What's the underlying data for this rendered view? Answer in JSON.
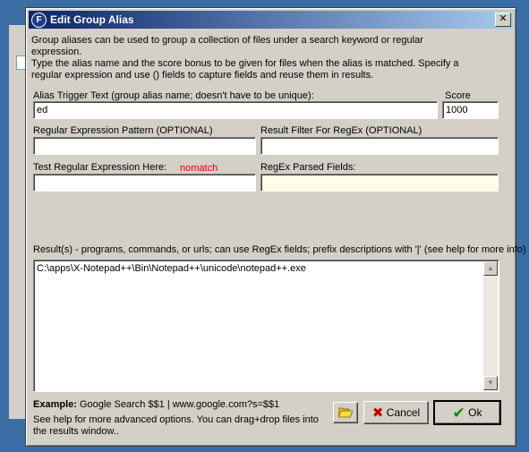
{
  "dialog": {
    "title": "Edit Group Alias",
    "app_icon_letter": "F",
    "close_glyph": "✕",
    "description": "Group aliases can be used to group a collection of files under a search keyword or regular expression.\nType the alias name and the score bonus to be given for files when the alias is matched.  Specify a regular expression and use () fields to capture fields and reuse them in results."
  },
  "fields": {
    "alias_label": "Alias Trigger Text (group alias name; doesn't have to be unique):",
    "alias_value": "ed",
    "score_label": "Score",
    "score_value": "1000",
    "regex_label": "Regular Expression Pattern (OPTIONAL)",
    "regex_value": "",
    "filter_label": "Result Filter For RegEx (OPTIONAL)",
    "filter_value": "",
    "test_label": "Test Regular Expression Here:",
    "test_value": "",
    "test_status": "nomatch",
    "parsed_label": "RegEx Parsed Fields:",
    "parsed_value": ""
  },
  "results": {
    "label": "Result(s) - programs, commands, or urls; can use RegEx fields; prefix descriptions with '|' (see help for more info)",
    "lines": [
      "C:\\apps\\X-Notepad++\\Bin\\Notepad++\\unicode\\notepad++.exe"
    ]
  },
  "footer": {
    "example_bold": "Example:",
    "example_text": " Google Search $$1 | www.google.com?s=$$1",
    "help_text": "See help for more advanced options.  You can drag+drop files into the results window.."
  },
  "buttons": {
    "cancel_label": "Cancel",
    "ok_label": "Ok"
  },
  "colors": {
    "title_start": "#0a246a",
    "title_end": "#a6caf0",
    "nomatch": "#e00000",
    "parsed_bg": "#ffffe7",
    "cancel_icon": "#c00000",
    "ok_icon": "#0a8a0a"
  }
}
